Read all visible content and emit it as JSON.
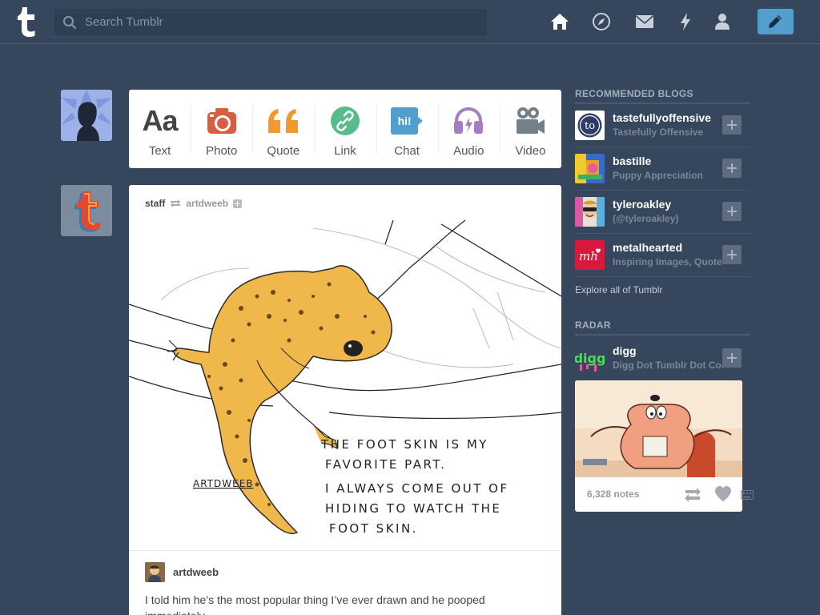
{
  "header": {
    "search_placeholder": "Search Tumblr",
    "nav_icons": [
      "home-icon",
      "explore-icon",
      "inbox-icon",
      "activity-icon",
      "account-icon"
    ],
    "compose_icon": "pencil-icon",
    "accent": "#529ecc",
    "background": "#36465d"
  },
  "post_types": [
    {
      "label": "Text",
      "icon": "text-icon",
      "glyph": "Aa",
      "color": "#444444"
    },
    {
      "label": "Photo",
      "icon": "camera-icon",
      "color": "#d95e40"
    },
    {
      "label": "Quote",
      "icon": "quote-icon",
      "color": "#f2992e"
    },
    {
      "label": "Link",
      "icon": "link-icon",
      "color": "#56bc8a"
    },
    {
      "label": "Chat",
      "icon": "chat-icon",
      "glyph": "hi!",
      "color": "#529ecc"
    },
    {
      "label": "Audio",
      "icon": "headphones-icon",
      "color": "#a77dc2"
    },
    {
      "label": "Video",
      "icon": "video-camera-icon",
      "color": "#748089"
    }
  ],
  "post": {
    "author": "staff",
    "reblogged_from": "artdweeb",
    "image_caption_lines": [
      "THE FOOT SKIN IS MY",
      "FAVORITE PART.",
      "I ALWAYS COME OUT OF",
      "HIDING TO WATCH THE",
      "FOOT SKIN."
    ],
    "signature": "ARTDWEEB",
    "reblog_user": "artdweeb",
    "text": "I told him he’s the most popular thing I’ve ever drawn and he pooped immediately."
  },
  "sidebar": {
    "recommended_title": "RECOMMENDED BLOGS",
    "blogs": [
      {
        "name": "tastefullyoffensive",
        "desc": "Tastefully Offensive",
        "avatar_text": "to"
      },
      {
        "name": "bastille",
        "desc": "Puppy Appreciation"
      },
      {
        "name": "tyleroakley",
        "desc": "(@tyleroakley)"
      },
      {
        "name": "metalhearted",
        "desc": "Inspiring Images, Quotes",
        "avatar_text": "mh"
      }
    ],
    "explore_label": "Explore all of Tumblr",
    "radar_title": "RADAR",
    "radar": {
      "name": "digg",
      "desc": "Digg Dot Tumblr Dot Com",
      "avatar_text": "digg",
      "notes": "6,328 notes"
    }
  }
}
